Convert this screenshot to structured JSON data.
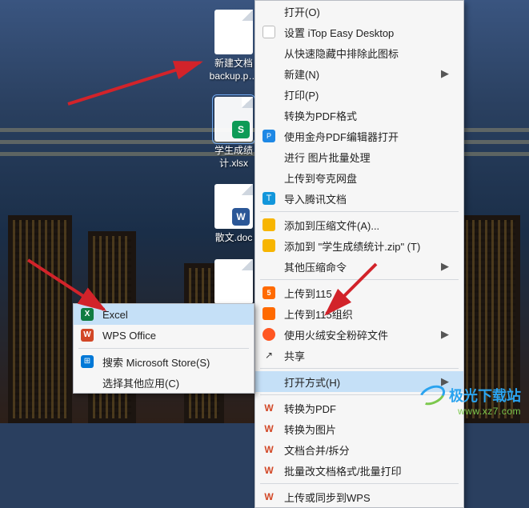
{
  "desktop": {
    "icons": [
      {
        "label": "新建文档\nbackup.p…",
        "badge": ""
      },
      {
        "label": "学生成绩\n计.xlsx",
        "badge": "S"
      },
      {
        "label": "散文.doc",
        "badge": "W"
      },
      {
        "label": ""
      }
    ]
  },
  "main_menu": {
    "items": [
      {
        "label": "打开(O)",
        "icon": ""
      },
      {
        "label": "设置 iTop Easy Desktop",
        "icon": "itop"
      },
      {
        "label": "从快速隐藏中排除此图标",
        "icon": ""
      },
      {
        "label": "新建(N)",
        "icon": "",
        "sub": true
      },
      {
        "label": "打印(P)",
        "icon": ""
      },
      {
        "label": "转换为PDF格式",
        "icon": ""
      },
      {
        "label": "使用金舟PDF编辑器打开",
        "icon": "pdf"
      },
      {
        "label": "进行 图片批量处理",
        "icon": ""
      },
      {
        "label": "上传到夸克网盘",
        "icon": ""
      },
      {
        "label": "导入腾讯文档",
        "icon": "tencent"
      },
      {
        "label": "添加到压缩文件(A)...",
        "icon": "zip"
      },
      {
        "label": "添加到 \"学生成绩统计.zip\" (T)",
        "icon": "zip"
      },
      {
        "label": "其他压缩命令",
        "icon": "",
        "sub": true
      },
      {
        "label": "上传到115",
        "icon": "115"
      },
      {
        "label": "上传到115组织",
        "icon": "115g"
      },
      {
        "label": "使用火绒安全粉碎文件",
        "icon": "fire",
        "sub": true
      },
      {
        "label": "共享",
        "icon": "share"
      },
      {
        "label": "打开方式(H)",
        "icon": "",
        "sub": true,
        "hov": true
      },
      {
        "label": "转换为PDF",
        "icon": "wps2"
      },
      {
        "label": "转换为图片",
        "icon": "wps2"
      },
      {
        "label": "文档合并/拆分",
        "icon": "wps2"
      },
      {
        "label": "批量改文档格式/批量打印",
        "icon": "wps2"
      },
      {
        "label": "上传或同步到WPS",
        "icon": "wps2"
      }
    ]
  },
  "sub_menu": {
    "items": [
      {
        "label": "Excel",
        "icon": "excel",
        "hov": true
      },
      {
        "label": "WPS Office",
        "icon": "wps"
      },
      {
        "label": "搜索 Microsoft Store(S)",
        "icon": "store"
      },
      {
        "label": "选择其他应用(C)",
        "icon": ""
      }
    ]
  },
  "watermark": {
    "title": "极光下载站",
    "url": "www.xz7.com"
  }
}
